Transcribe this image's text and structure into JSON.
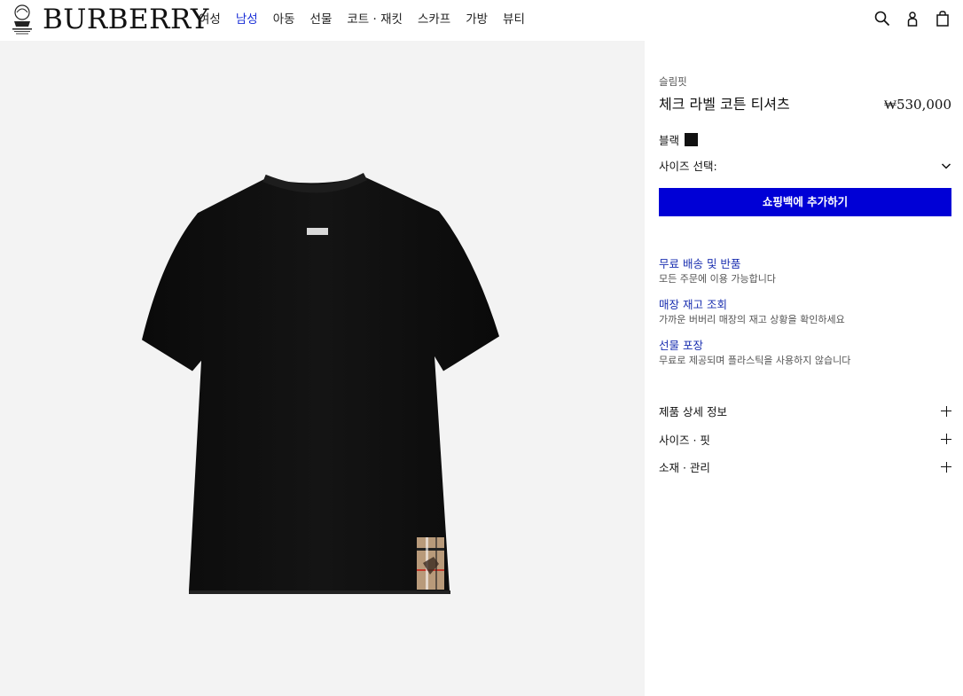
{
  "brand": {
    "wordmark": "BURBERRY"
  },
  "nav": {
    "items": [
      {
        "label": "여성",
        "active": false
      },
      {
        "label": "남성",
        "active": true
      },
      {
        "label": "아동",
        "active": false
      },
      {
        "label": "선물",
        "active": false
      },
      {
        "label": "코트 · 재킷",
        "active": false
      },
      {
        "label": "스카프",
        "active": false
      },
      {
        "label": "가방",
        "active": false
      },
      {
        "label": "뷰티",
        "active": false
      }
    ]
  },
  "header_icons": [
    "search-icon",
    "account-icon",
    "shopping-bag-icon"
  ],
  "product": {
    "fit": "슬림핏",
    "title": "체크 라벨 코튼 티셔츠",
    "price": "₩530,000",
    "color_name": "블랙",
    "color_hex": "#111111",
    "size_select_label": "사이즈 선택:",
    "add_to_bag": "쇼핑백에 추가하기"
  },
  "services": [
    {
      "title": "무료 배송 및 반품",
      "desc": "모든 주문에 이용 가능합니다"
    },
    {
      "title": "매장 재고 조회",
      "desc": "가까운 버버리 매장의 재고 상황을 확인하세요"
    },
    {
      "title": "선물 포장",
      "desc": "무료로 제공되며 플라스틱을 사용하지 않습니다"
    }
  ],
  "accordions": [
    {
      "label": "제품 상세 정보"
    },
    {
      "label": "사이즈 · 핏"
    },
    {
      "label": "소재 · 관리"
    }
  ],
  "colors": {
    "accent_button": "#0000d6",
    "link": "#1a2fb0",
    "gallery_bg": "#f3f3f3"
  }
}
